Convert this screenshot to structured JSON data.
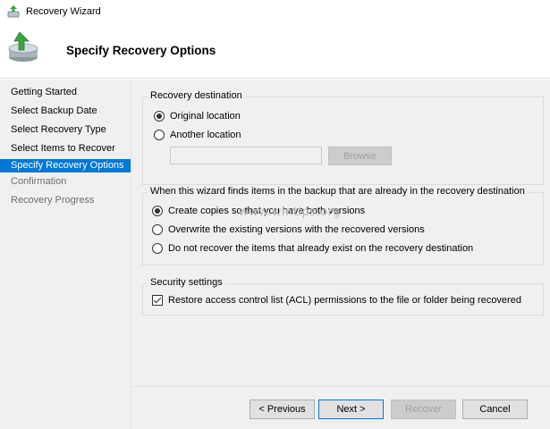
{
  "window": {
    "title": "Recovery Wizard",
    "icon": "recovery-wizard-icon"
  },
  "header": {
    "title": "Specify Recovery Options",
    "icon": "backup-disk-arrow-icon"
  },
  "sidebar": {
    "steps": [
      {
        "label": "Getting Started",
        "state": "done"
      },
      {
        "label": "Select Backup Date",
        "state": "done"
      },
      {
        "label": "Select Recovery Type",
        "state": "done"
      },
      {
        "label": "Select Items to Recover",
        "state": "done"
      },
      {
        "label": "Specify Recovery Options",
        "state": "active"
      },
      {
        "label": "Confirmation",
        "state": "pending"
      },
      {
        "label": "Recovery Progress",
        "state": "pending"
      }
    ]
  },
  "recovery_destination": {
    "legend": "Recovery destination",
    "options": [
      {
        "label": "Original location",
        "selected": true
      },
      {
        "label": "Another location",
        "selected": false
      }
    ],
    "path_value": "",
    "browse_label": "Browse"
  },
  "existing_items": {
    "legend": "When this wizard finds items in the backup that are already in the recovery destination",
    "options": [
      {
        "label": "Create copies so that you have both versions",
        "selected": true
      },
      {
        "label": "Overwrite the existing versions with the recovered versions",
        "selected": false
      },
      {
        "label": "Do not recover the items that already exist on the recovery destination",
        "selected": false
      }
    ]
  },
  "security": {
    "legend": "Security settings",
    "acl_label": "Restore access control list (ACL) permissions to the file or folder being recovered",
    "acl_checked": true
  },
  "watermark": "www.wintips.org",
  "buttons": {
    "previous": "< Previous",
    "next": "Next >",
    "recover": "Recover",
    "cancel": "Cancel"
  },
  "colors": {
    "accent": "#0078d7",
    "panel_bg": "#f0f0f0"
  }
}
